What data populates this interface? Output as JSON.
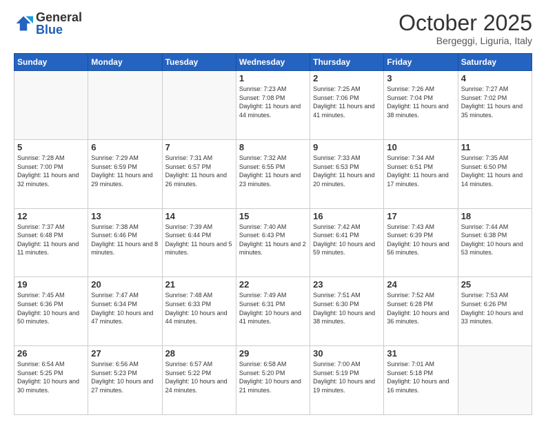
{
  "header": {
    "logo": {
      "line1": "General",
      "line2": "Blue"
    },
    "title": "October 2025",
    "subtitle": "Bergeggi, Liguria, Italy"
  },
  "days_of_week": [
    "Sunday",
    "Monday",
    "Tuesday",
    "Wednesday",
    "Thursday",
    "Friday",
    "Saturday"
  ],
  "weeks": [
    [
      {
        "day": "",
        "sunrise": "",
        "sunset": "",
        "daylight": ""
      },
      {
        "day": "",
        "sunrise": "",
        "sunset": "",
        "daylight": ""
      },
      {
        "day": "",
        "sunrise": "",
        "sunset": "",
        "daylight": ""
      },
      {
        "day": "1",
        "sunrise": "Sunrise: 7:23 AM",
        "sunset": "Sunset: 7:08 PM",
        "daylight": "Daylight: 11 hours and 44 minutes."
      },
      {
        "day": "2",
        "sunrise": "Sunrise: 7:25 AM",
        "sunset": "Sunset: 7:06 PM",
        "daylight": "Daylight: 11 hours and 41 minutes."
      },
      {
        "day": "3",
        "sunrise": "Sunrise: 7:26 AM",
        "sunset": "Sunset: 7:04 PM",
        "daylight": "Daylight: 11 hours and 38 minutes."
      },
      {
        "day": "4",
        "sunrise": "Sunrise: 7:27 AM",
        "sunset": "Sunset: 7:02 PM",
        "daylight": "Daylight: 11 hours and 35 minutes."
      }
    ],
    [
      {
        "day": "5",
        "sunrise": "Sunrise: 7:28 AM",
        "sunset": "Sunset: 7:00 PM",
        "daylight": "Daylight: 11 hours and 32 minutes."
      },
      {
        "day": "6",
        "sunrise": "Sunrise: 7:29 AM",
        "sunset": "Sunset: 6:59 PM",
        "daylight": "Daylight: 11 hours and 29 minutes."
      },
      {
        "day": "7",
        "sunrise": "Sunrise: 7:31 AM",
        "sunset": "Sunset: 6:57 PM",
        "daylight": "Daylight: 11 hours and 26 minutes."
      },
      {
        "day": "8",
        "sunrise": "Sunrise: 7:32 AM",
        "sunset": "Sunset: 6:55 PM",
        "daylight": "Daylight: 11 hours and 23 minutes."
      },
      {
        "day": "9",
        "sunrise": "Sunrise: 7:33 AM",
        "sunset": "Sunset: 6:53 PM",
        "daylight": "Daylight: 11 hours and 20 minutes."
      },
      {
        "day": "10",
        "sunrise": "Sunrise: 7:34 AM",
        "sunset": "Sunset: 6:51 PM",
        "daylight": "Daylight: 11 hours and 17 minutes."
      },
      {
        "day": "11",
        "sunrise": "Sunrise: 7:35 AM",
        "sunset": "Sunset: 6:50 PM",
        "daylight": "Daylight: 11 hours and 14 minutes."
      }
    ],
    [
      {
        "day": "12",
        "sunrise": "Sunrise: 7:37 AM",
        "sunset": "Sunset: 6:48 PM",
        "daylight": "Daylight: 11 hours and 11 minutes."
      },
      {
        "day": "13",
        "sunrise": "Sunrise: 7:38 AM",
        "sunset": "Sunset: 6:46 PM",
        "daylight": "Daylight: 11 hours and 8 minutes."
      },
      {
        "day": "14",
        "sunrise": "Sunrise: 7:39 AM",
        "sunset": "Sunset: 6:44 PM",
        "daylight": "Daylight: 11 hours and 5 minutes."
      },
      {
        "day": "15",
        "sunrise": "Sunrise: 7:40 AM",
        "sunset": "Sunset: 6:43 PM",
        "daylight": "Daylight: 11 hours and 2 minutes."
      },
      {
        "day": "16",
        "sunrise": "Sunrise: 7:42 AM",
        "sunset": "Sunset: 6:41 PM",
        "daylight": "Daylight: 10 hours and 59 minutes."
      },
      {
        "day": "17",
        "sunrise": "Sunrise: 7:43 AM",
        "sunset": "Sunset: 6:39 PM",
        "daylight": "Daylight: 10 hours and 56 minutes."
      },
      {
        "day": "18",
        "sunrise": "Sunrise: 7:44 AM",
        "sunset": "Sunset: 6:38 PM",
        "daylight": "Daylight: 10 hours and 53 minutes."
      }
    ],
    [
      {
        "day": "19",
        "sunrise": "Sunrise: 7:45 AM",
        "sunset": "Sunset: 6:36 PM",
        "daylight": "Daylight: 10 hours and 50 minutes."
      },
      {
        "day": "20",
        "sunrise": "Sunrise: 7:47 AM",
        "sunset": "Sunset: 6:34 PM",
        "daylight": "Daylight: 10 hours and 47 minutes."
      },
      {
        "day": "21",
        "sunrise": "Sunrise: 7:48 AM",
        "sunset": "Sunset: 6:33 PM",
        "daylight": "Daylight: 10 hours and 44 minutes."
      },
      {
        "day": "22",
        "sunrise": "Sunrise: 7:49 AM",
        "sunset": "Sunset: 6:31 PM",
        "daylight": "Daylight: 10 hours and 41 minutes."
      },
      {
        "day": "23",
        "sunrise": "Sunrise: 7:51 AM",
        "sunset": "Sunset: 6:30 PM",
        "daylight": "Daylight: 10 hours and 38 minutes."
      },
      {
        "day": "24",
        "sunrise": "Sunrise: 7:52 AM",
        "sunset": "Sunset: 6:28 PM",
        "daylight": "Daylight: 10 hours and 36 minutes."
      },
      {
        "day": "25",
        "sunrise": "Sunrise: 7:53 AM",
        "sunset": "Sunset: 6:26 PM",
        "daylight": "Daylight: 10 hours and 33 minutes."
      }
    ],
    [
      {
        "day": "26",
        "sunrise": "Sunrise: 6:54 AM",
        "sunset": "Sunset: 5:25 PM",
        "daylight": "Daylight: 10 hours and 30 minutes."
      },
      {
        "day": "27",
        "sunrise": "Sunrise: 6:56 AM",
        "sunset": "Sunset: 5:23 PM",
        "daylight": "Daylight: 10 hours and 27 minutes."
      },
      {
        "day": "28",
        "sunrise": "Sunrise: 6:57 AM",
        "sunset": "Sunset: 5:22 PM",
        "daylight": "Daylight: 10 hours and 24 minutes."
      },
      {
        "day": "29",
        "sunrise": "Sunrise: 6:58 AM",
        "sunset": "Sunset: 5:20 PM",
        "daylight": "Daylight: 10 hours and 21 minutes."
      },
      {
        "day": "30",
        "sunrise": "Sunrise: 7:00 AM",
        "sunset": "Sunset: 5:19 PM",
        "daylight": "Daylight: 10 hours and 19 minutes."
      },
      {
        "day": "31",
        "sunrise": "Sunrise: 7:01 AM",
        "sunset": "Sunset: 5:18 PM",
        "daylight": "Daylight: 10 hours and 16 minutes."
      },
      {
        "day": "",
        "sunrise": "",
        "sunset": "",
        "daylight": ""
      }
    ]
  ]
}
